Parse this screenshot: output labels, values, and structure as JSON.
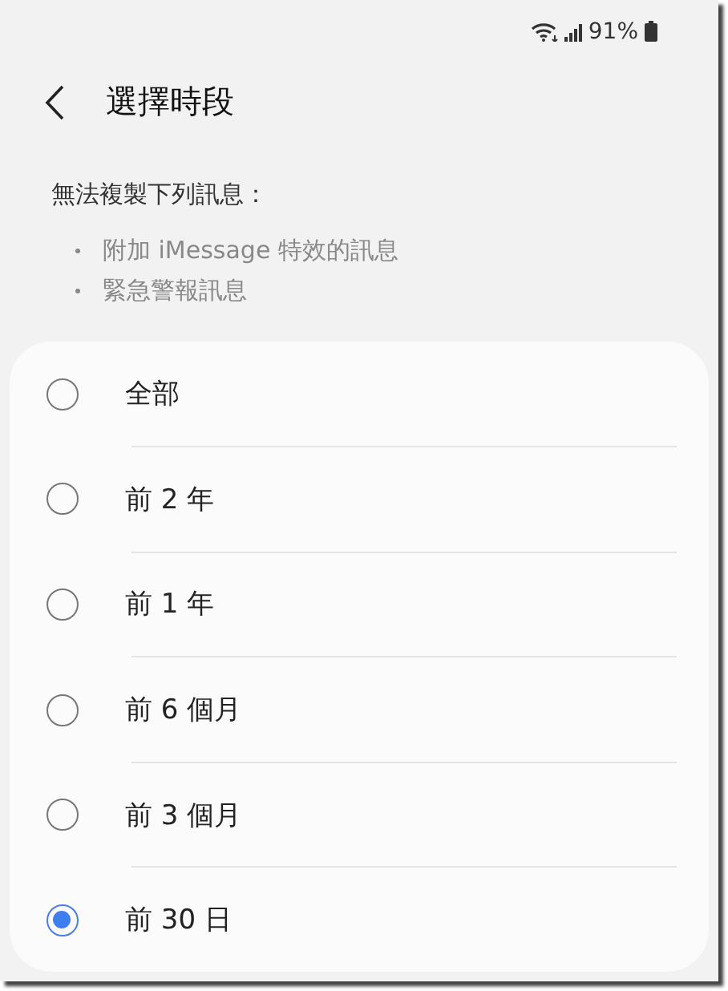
{
  "status_bar": {
    "battery_text": "91%"
  },
  "header": {
    "title": "選擇時段"
  },
  "notice": {
    "text": "無法複製下列訊息：",
    "items": [
      "附加 iMessage 特效的訊息",
      "緊急警報訊息"
    ]
  },
  "options": [
    {
      "label": "全部",
      "selected": false
    },
    {
      "label": "前 2 年",
      "selected": false
    },
    {
      "label": "前 1 年",
      "selected": false
    },
    {
      "label": "前 6 個月",
      "selected": false
    },
    {
      "label": "前 3 個月",
      "selected": false
    },
    {
      "label": "前 30 日",
      "selected": true
    }
  ]
}
